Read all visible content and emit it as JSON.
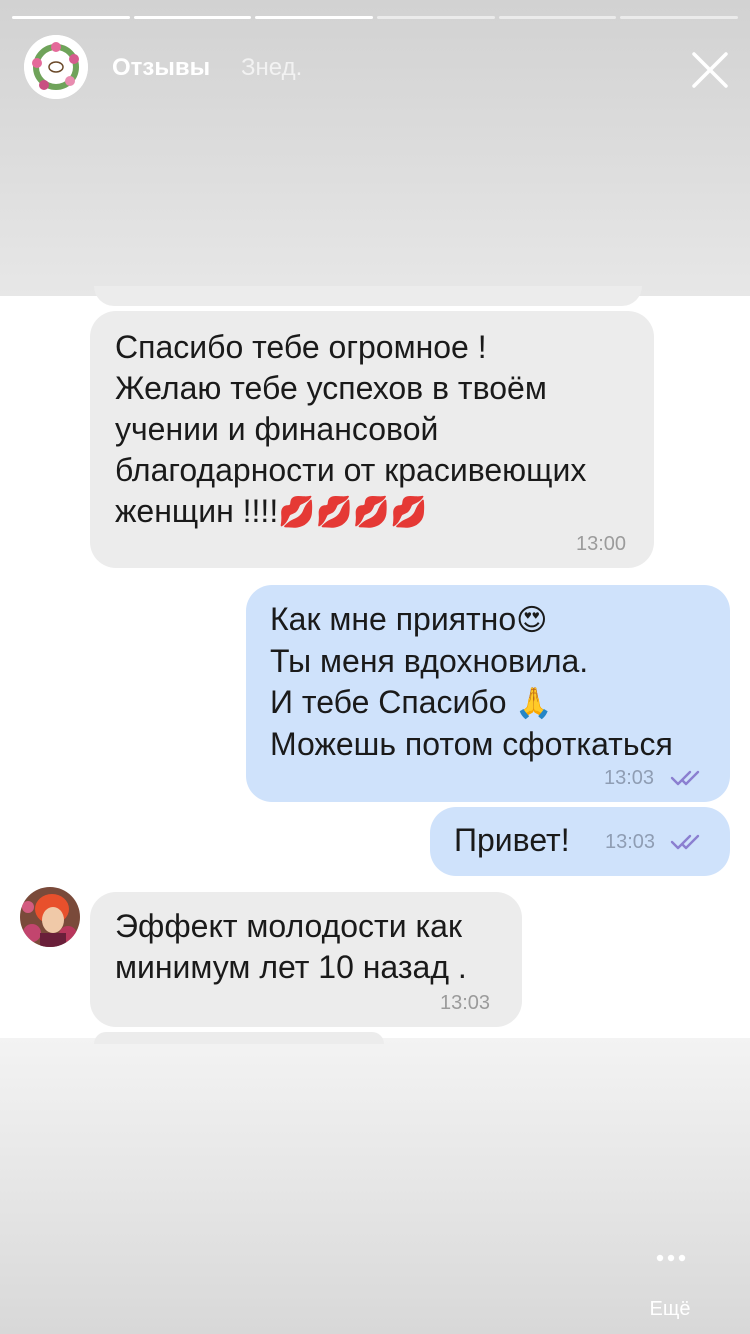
{
  "story": {
    "title": "Отзывы",
    "time": "Знед.",
    "progress": [
      1,
      1,
      1,
      0,
      0,
      0
    ]
  },
  "messages": [
    {
      "text": "Спасибо тебе огромное !\nЖелаю тебе успехов в твоём\nучении и финансовой\nблагодарности от красивеющих\nженщин !!!!",
      "emoji": "💋💋💋💋",
      "time": "13:00"
    },
    {
      "lines": [
        "Как мне приятно",
        "Ты меня вдохновила.",
        "И тебе Спасибо ",
        "Можешь потом сфоткаться"
      ],
      "emoji1": "😍",
      "emoji2": "🙏",
      "time": "13:03"
    },
    {
      "text": "Привет!",
      "time": "13:03"
    },
    {
      "text": "Эффект молодости как\nминимум лет 10 назад .",
      "time": "13:03"
    }
  ],
  "more": {
    "label": "Ещё"
  },
  "colors": {
    "incoming": "#ececec",
    "outgoing": "#cfe2fb",
    "ticks": "#8b7fd0",
    "kiss": "#d12b3a"
  },
  "icons": {
    "close": "close-icon",
    "more": "more-dots-icon",
    "read": "double-check-icon"
  }
}
